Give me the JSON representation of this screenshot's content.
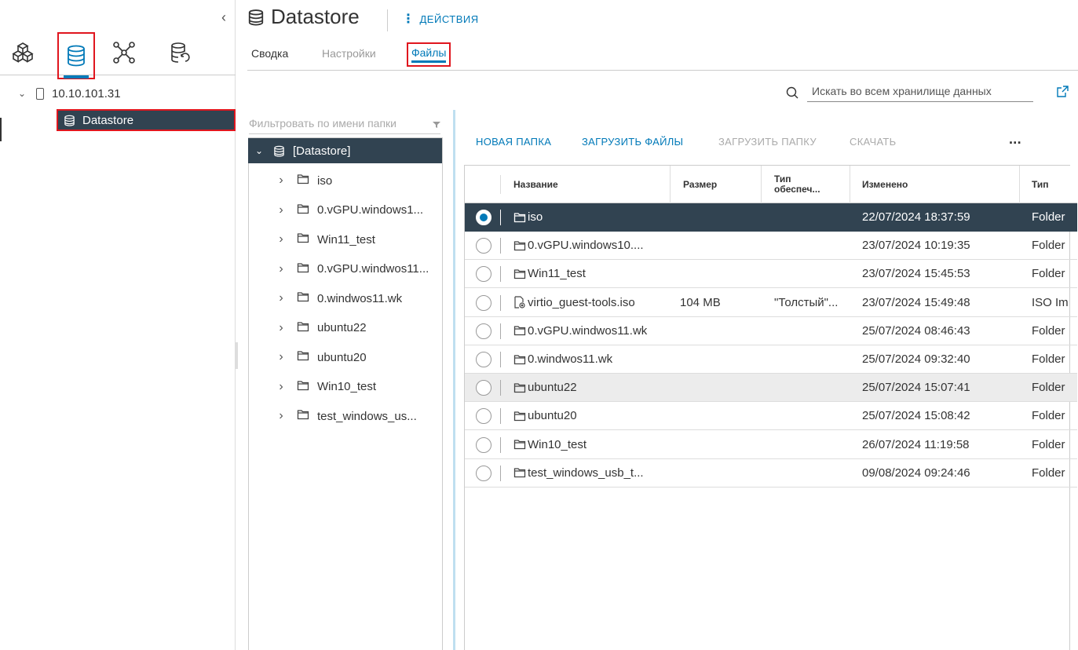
{
  "header": {
    "title": "Datastore",
    "actions_label": "ДЕЙСТВИЯ"
  },
  "tabs": {
    "summary": "Сводка",
    "settings": "Настройки",
    "files": "Файлы"
  },
  "navigator": {
    "host": "10.10.101.31",
    "datastore": "Datastore"
  },
  "search": {
    "placeholder": "Искать во всем хранилище данных"
  },
  "folder_tree": {
    "filter_placeholder": "Фильтровать по имени папки",
    "root": "[Datastore]",
    "items": [
      "iso",
      "0.vGPU.windows1...",
      "Win11_test",
      "0.vGPU.windwos11...",
      "0.windwos11.wk",
      "ubuntu22",
      "ubuntu20",
      "Win10_test",
      "test_windows_us..."
    ]
  },
  "toolbar": {
    "new_folder": "НОВАЯ ПАПКА",
    "upload_files": "ЗАГРУЗИТЬ ФАЙЛЫ",
    "upload_folder": "ЗАГРУЗИТЬ ПАПКУ",
    "download": "СКАЧАТЬ",
    "more": "..."
  },
  "grid": {
    "columns": {
      "name": "Название",
      "size": "Размер",
      "provisioning": "Тип обеспеч...",
      "modified": "Изменено",
      "type": "Тип"
    },
    "rows": [
      {
        "name": "iso",
        "icon": "folder-icon",
        "size": "",
        "provisioning": "",
        "modified": "22/07/2024 18:37:59",
        "type": "Folder",
        "selected": true
      },
      {
        "name": "0.vGPU.windows10....",
        "icon": "folder-icon",
        "size": "",
        "provisioning": "",
        "modified": "23/07/2024 10:19:35",
        "type": "Folder"
      },
      {
        "name": "Win11_test",
        "icon": "folder-icon",
        "size": "",
        "provisioning": "",
        "modified": "23/07/2024 15:45:53",
        "type": "Folder"
      },
      {
        "name": "virtio_guest-tools.iso",
        "icon": "iso-file-icon",
        "size": "104 MB",
        "provisioning": "\"Толстый\"...",
        "modified": "23/07/2024 15:49:48",
        "type": "ISO Im"
      },
      {
        "name": "0.vGPU.windwos11.wk",
        "icon": "folder-icon",
        "size": "",
        "provisioning": "",
        "modified": "25/07/2024 08:46:43",
        "type": "Folder"
      },
      {
        "name": "0.windwos11.wk",
        "icon": "folder-icon",
        "size": "",
        "provisioning": "",
        "modified": "25/07/2024 09:32:40",
        "type": "Folder"
      },
      {
        "name": "ubuntu22",
        "icon": "folder-icon",
        "size": "",
        "provisioning": "",
        "modified": "25/07/2024 15:07:41",
        "type": "Folder",
        "hover": true
      },
      {
        "name": "ubuntu20",
        "icon": "folder-icon",
        "size": "",
        "provisioning": "",
        "modified": "25/07/2024 15:08:42",
        "type": "Folder"
      },
      {
        "name": "Win10_test",
        "icon": "folder-icon",
        "size": "",
        "provisioning": "",
        "modified": "26/07/2024 11:19:58",
        "type": "Folder"
      },
      {
        "name": "test_windows_usb_t...",
        "icon": "folder-icon",
        "size": "",
        "provisioning": "",
        "modified": "09/08/2024 09:24:46",
        "type": "Folder"
      }
    ]
  },
  "colors": {
    "accent": "#0079b8",
    "selected_bg": "#314351",
    "highlight_box": "#e0161e"
  }
}
